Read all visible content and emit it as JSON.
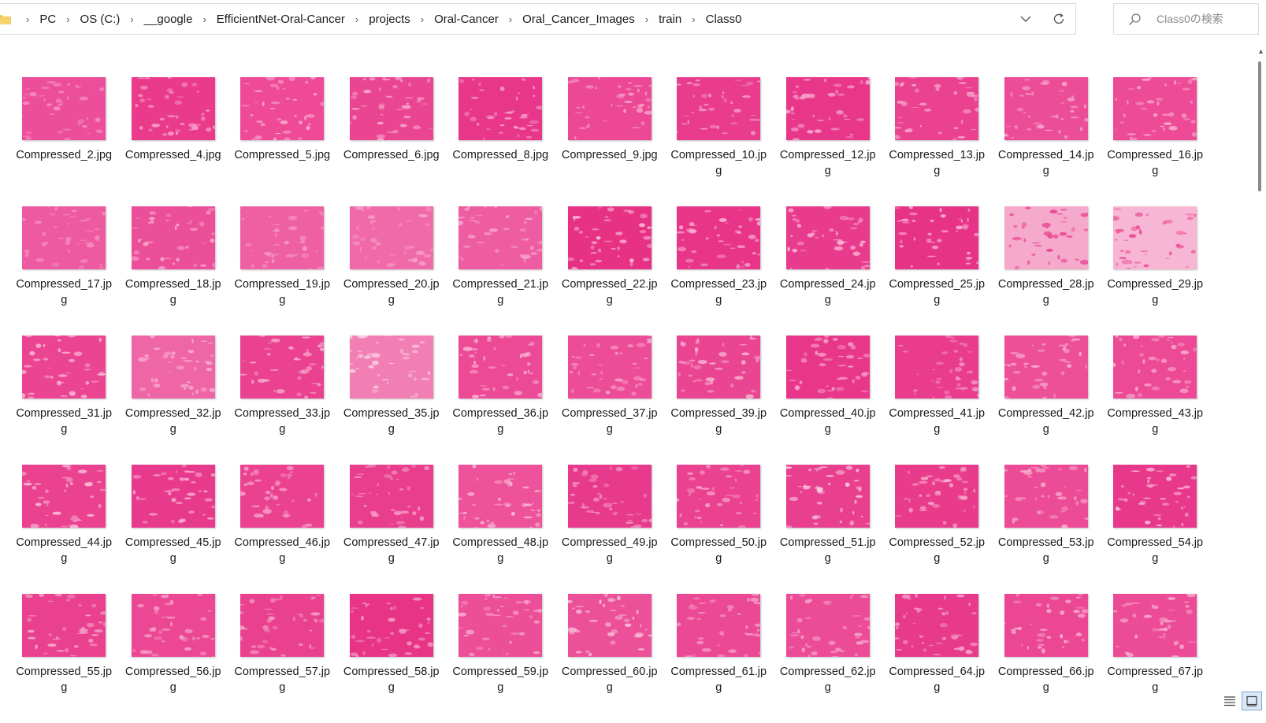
{
  "address_bar": {
    "breadcrumbs": [
      "PC",
      "OS (C:)",
      "__google",
      "EfficientNet-Oral-Cancer",
      "projects",
      "Oral-Cancer",
      "Oral_Cancer_Images",
      "train",
      "Class0"
    ]
  },
  "search": {
    "placeholder": "Class0の検索"
  },
  "files": [
    {
      "name": "Compressed_2.jpg",
      "tone": "#ec4e9c",
      "tex": "#f78fc2"
    },
    {
      "name": "Compressed_4.jpg",
      "tone": "#e93a8c",
      "tex": "#f8a0c8"
    },
    {
      "name": "Compressed_5.jpg",
      "tone": "#ee4a98",
      "tex": "#fbb8d4"
    },
    {
      "name": "Compressed_6.jpg",
      "tone": "#ea4592",
      "tex": "#fab0d0"
    },
    {
      "name": "Compressed_8.jpg",
      "tone": "#e8378a",
      "tex": "#f8a3ca"
    },
    {
      "name": "Compressed_9.jpg",
      "tone": "#ec4895",
      "tex": "#f7a6cb"
    },
    {
      "name": "Compressed_10.jpg",
      "tone": "#e93c8e",
      "tex": "#f59bc5"
    },
    {
      "name": "Compressed_12.jpg",
      "tone": "#e8378b",
      "tex": "#f7a7cb"
    },
    {
      "name": "Compressed_13.jpg",
      "tone": "#ea4290",
      "tex": "#f8aace"
    },
    {
      "name": "Compressed_14.jpg",
      "tone": "#ec4d98",
      "tex": "#f8a9cc"
    },
    {
      "name": "Compressed_16.jpg",
      "tone": "#ed4a97",
      "tex": "#fab3d2"
    },
    {
      "name": "Compressed_17.jpg",
      "tone": "#ee5aa1",
      "tex": "#f792c2"
    },
    {
      "name": "Compressed_18.jpg",
      "tone": "#ec4f99",
      "tex": "#f8abcf"
    },
    {
      "name": "Compressed_19.jpg",
      "tone": "#ef5fa4",
      "tex": "#f7a0c9"
    },
    {
      "name": "Compressed_20.jpg",
      "tone": "#f06aa9",
      "tex": "#f99fc8"
    },
    {
      "name": "Compressed_21.jpg",
      "tone": "#ee5ca2",
      "tex": "#f9aace"
    },
    {
      "name": "Compressed_22.jpg",
      "tone": "#e73185",
      "tex": "#fbc0da"
    },
    {
      "name": "Compressed_23.jpg",
      "tone": "#e8358a",
      "tex": "#fab5d3"
    },
    {
      "name": "Compressed_24.jpg",
      "tone": "#e93b8d",
      "tex": "#fbbcd7"
    },
    {
      "name": "Compressed_25.jpg",
      "tone": "#e73387",
      "tex": "#f9b2d1"
    },
    {
      "name": "Compressed_28.jpg",
      "tone": "#f5a9cb",
      "tex": "#e9408f"
    },
    {
      "name": "Compressed_29.jpg",
      "tone": "#f7b6d3",
      "tex": "#ea4691"
    },
    {
      "name": "Compressed_31.jpg",
      "tone": "#eb4492",
      "tex": "#fab8d5"
    },
    {
      "name": "Compressed_32.jpg",
      "tone": "#ef66a7",
      "tex": "#f9b0cf"
    },
    {
      "name": "Compressed_33.jpg",
      "tone": "#ea4190",
      "tex": "#f9b3d1"
    },
    {
      "name": "Compressed_35.jpg",
      "tone": "#f27fb4",
      "tex": "#fcd0e2"
    },
    {
      "name": "Compressed_36.jpg",
      "tone": "#ec4a96",
      "tex": "#fbbcd8"
    },
    {
      "name": "Compressed_37.jpg",
      "tone": "#ed4c98",
      "tex": "#f9afcf"
    },
    {
      "name": "Compressed_39.jpg",
      "tone": "#ea4592",
      "tex": "#fab6d3"
    },
    {
      "name": "Compressed_40.jpg",
      "tone": "#e8378b",
      "tex": "#f8a5ca"
    },
    {
      "name": "Compressed_41.jpg",
      "tone": "#e93c8e",
      "tex": "#f59ac4"
    },
    {
      "name": "Compressed_42.jpg",
      "tone": "#ed4f99",
      "tex": "#fab7d4"
    },
    {
      "name": "Compressed_43.jpg",
      "tone": "#ec4a96",
      "tex": "#f9aacd"
    },
    {
      "name": "Compressed_44.jpg",
      "tone": "#ea4290",
      "tex": "#fbc1da"
    },
    {
      "name": "Compressed_45.jpg",
      "tone": "#e83a8c",
      "tex": "#f9b0cf"
    },
    {
      "name": "Compressed_46.jpg",
      "tone": "#ea4191",
      "tex": "#f8a1c9"
    },
    {
      "name": "Compressed_47.jpg",
      "tone": "#e93d8e",
      "tex": "#f6a0c7"
    },
    {
      "name": "Compressed_48.jpg",
      "tone": "#ed529b",
      "tex": "#fbc3db"
    },
    {
      "name": "Compressed_49.jpg",
      "tone": "#e83a8c",
      "tex": "#f59cc5"
    },
    {
      "name": "Compressed_50.jpg",
      "tone": "#ea4190",
      "tex": "#f7a2c9"
    },
    {
      "name": "Compressed_51.jpg",
      "tone": "#e93f8f",
      "tex": "#fcd0e2"
    },
    {
      "name": "Compressed_52.jpg",
      "tone": "#e83b8c",
      "tex": "#f9b5d2"
    },
    {
      "name": "Compressed_53.jpg",
      "tone": "#ec4c97",
      "tex": "#f9b2d0"
    },
    {
      "name": "Compressed_54.jpg",
      "tone": "#e8388b",
      "tex": "#fbc4dc"
    },
    {
      "name": "Compressed_55.jpg",
      "tone": "#e9408f",
      "tex": "#f8a8cc"
    },
    {
      "name": "Compressed_56.jpg",
      "tone": "#eb4794",
      "tex": "#f7a6cb"
    },
    {
      "name": "Compressed_57.jpg",
      "tone": "#e9418f",
      "tex": "#f59dc5"
    },
    {
      "name": "Compressed_58.jpg",
      "tone": "#e73487",
      "tex": "#f49bc4"
    },
    {
      "name": "Compressed_59.jpg",
      "tone": "#ec4e98",
      "tex": "#f9aacd"
    },
    {
      "name": "Compressed_60.jpg",
      "tone": "#ec5098",
      "tex": "#fbc2da"
    },
    {
      "name": "Compressed_61.jpg",
      "tone": "#eb4895",
      "tex": "#f7a0c8"
    },
    {
      "name": "Compressed_62.jpg",
      "tone": "#ec4c97",
      "tex": "#f7a4ca"
    },
    {
      "name": "Compressed_64.jpg",
      "tone": "#e83a8c",
      "tex": "#f8a6cb"
    },
    {
      "name": "Compressed_66.jpg",
      "tone": "#eb4794",
      "tex": "#f9aece"
    },
    {
      "name": "Compressed_67.jpg",
      "tone": "#ec4b97",
      "tex": "#f8a9cd"
    }
  ]
}
